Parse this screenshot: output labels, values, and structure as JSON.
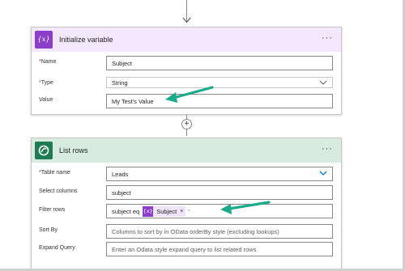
{
  "colors": {
    "variable_accent": "#8b3fc8",
    "variable_header_bg": "#f3e8fd",
    "dataverse_accent": "#1e7b52",
    "dataverse_header_bg": "#d7ebdf",
    "annotation_arrow": "#1bab8c",
    "dropdown_chevron_blue": "#0078d4",
    "required_star": "#a4262c"
  },
  "initialize_variable": {
    "icon": "variable-icon",
    "icon_glyph": "{x}",
    "title": "Initialize variable",
    "more_glyph": "···",
    "fields": {
      "name": {
        "required": "*",
        "label": "Name",
        "value": "Subject"
      },
      "type": {
        "required": "*",
        "label": "Type",
        "value": "String"
      },
      "value": {
        "label": "Value",
        "value": "My Test's Value"
      }
    }
  },
  "connector": {
    "plus_glyph": "+"
  },
  "list_rows": {
    "icon": "dataverse-icon",
    "title": "List rows",
    "more_glyph": "···",
    "fields": {
      "table_name": {
        "required": "*",
        "label": "Table name",
        "value": "Leads"
      },
      "select_columns": {
        "label": "Select columns",
        "value": "subject"
      },
      "filter_rows": {
        "label": "Filter rows",
        "prefix": "subject eq",
        "token_icon": "{x}",
        "token_label": "Subject",
        "token_remove": "×",
        "suffix": "'"
      },
      "sort_by": {
        "label": "Sort By",
        "placeholder": "Columns to sort by in OData orderBy style (excluding lookups)"
      },
      "expand_query": {
        "label": "Expand Query",
        "placeholder": "Enter an Odata style expand query to list related rows"
      }
    }
  }
}
